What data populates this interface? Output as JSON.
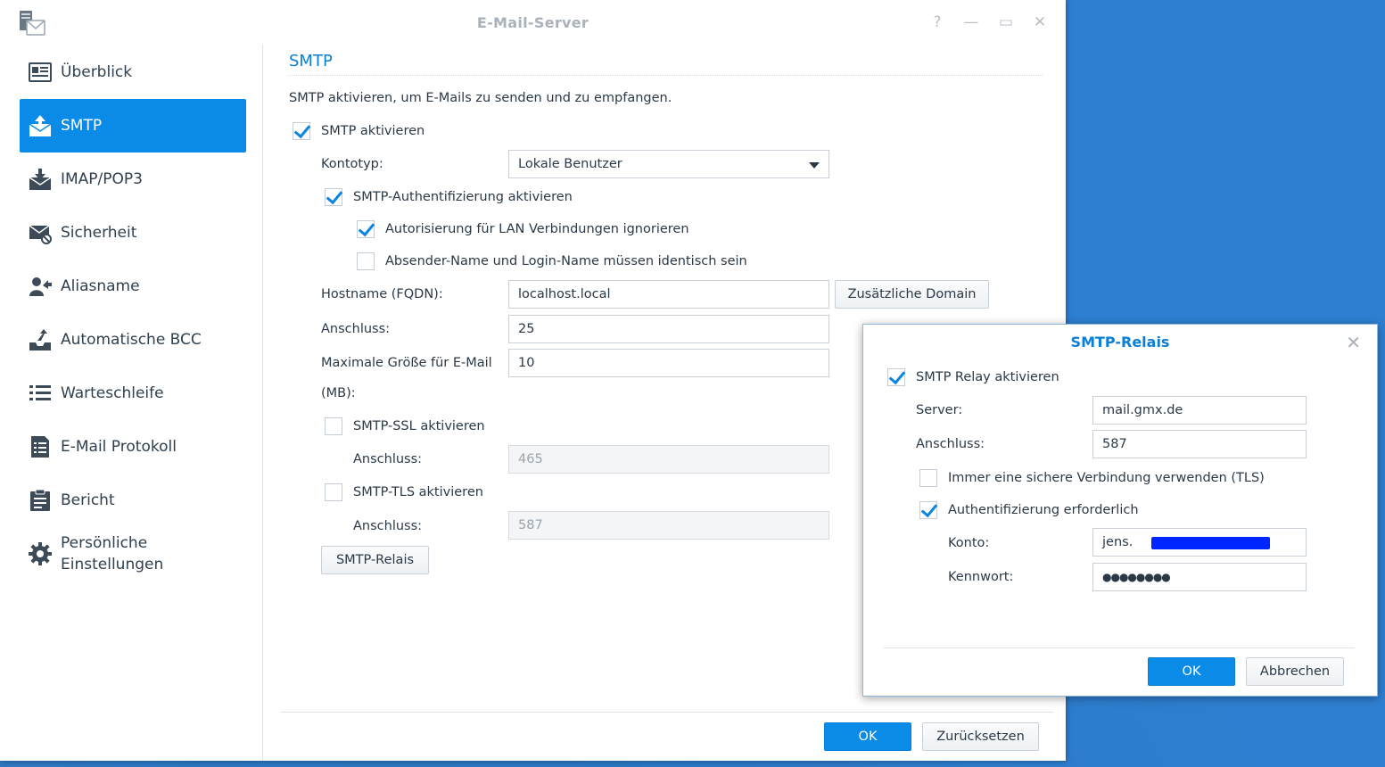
{
  "window": {
    "title": "E-Mail-Server",
    "help_icon": "?",
    "minimize_icon": "—",
    "maximize_icon": "▭",
    "close_icon": "✕"
  },
  "sidebar": {
    "items": [
      {
        "label": "Überblick",
        "icon": "overview-icon"
      },
      {
        "label": "SMTP",
        "icon": "smtp-icon",
        "active": true
      },
      {
        "label": "IMAP/POP3",
        "icon": "imap-icon"
      },
      {
        "label": "Sicherheit",
        "icon": "security-icon"
      },
      {
        "label": "Aliasname",
        "icon": "alias-icon"
      },
      {
        "label": "Automatische BCC",
        "icon": "bcc-icon"
      },
      {
        "label": "Warteschleife",
        "icon": "queue-icon"
      },
      {
        "label": "E-Mail Protokoll",
        "icon": "log-icon"
      },
      {
        "label": "Bericht",
        "icon": "report-icon"
      },
      {
        "label": "Persönliche",
        "label2": "Einstellungen",
        "icon": "gear-icon"
      }
    ]
  },
  "smtp": {
    "title": "SMTP",
    "description": "SMTP aktivieren, um E-Mails zu senden und zu empfangen.",
    "enable_label": "SMTP aktivieren",
    "enable_checked": true,
    "account_type_label": "Kontotyp:",
    "account_type_value": "Lokale Benutzer",
    "auth_label": "SMTP-Authentifizierung aktivieren",
    "auth_checked": true,
    "lan_label": "Autorisierung für LAN Verbindungen ignorieren",
    "lan_checked": true,
    "identical_label": "Absender-Name und Login-Name müssen identisch sein",
    "identical_checked": false,
    "hostname_label": "Hostname (FQDN):",
    "hostname_value": "localhost.local",
    "extra_domain_button": "Zusätzliche Domain",
    "port_label": "Anschluss:",
    "port_value": "25",
    "max_size_label_1": "Maximale Größe für E-Mail",
    "max_size_label_2": "(MB):",
    "max_size_value": "10",
    "ssl_label": "SMTP-SSL aktivieren",
    "ssl_checked": false,
    "ssl_port_label": "Anschluss:",
    "ssl_port_value": "465",
    "tls_label": "SMTP-TLS aktivieren",
    "tls_checked": false,
    "tls_port_label": "Anschluss:",
    "tls_port_value": "587",
    "relay_button": "SMTP-Relais"
  },
  "footer": {
    "ok": "OK",
    "reset": "Zurücksetzen"
  },
  "relay_dialog": {
    "title": "SMTP-Relais",
    "close_icon": "✕",
    "enable_label": "SMTP Relay aktivieren",
    "enable_checked": true,
    "server_label": "Server:",
    "server_value": "mail.gmx.de",
    "port_label": "Anschluss:",
    "port_value": "587",
    "tls_label": "Immer eine sichere Verbindung verwenden (TLS)",
    "tls_checked": false,
    "auth_label": "Authentifizierung erforderlich",
    "auth_checked": true,
    "account_label": "Konto:",
    "account_value": "jens.",
    "password_label": "Kennwort:",
    "password_value": "●●●●●●●●",
    "ok": "OK",
    "cancel": "Abbrechen"
  },
  "colors": {
    "accent": "#0a8be8",
    "title_blue": "#0a7fd6",
    "desktop": "#2e7fd1",
    "redaction": "#0026ff"
  }
}
